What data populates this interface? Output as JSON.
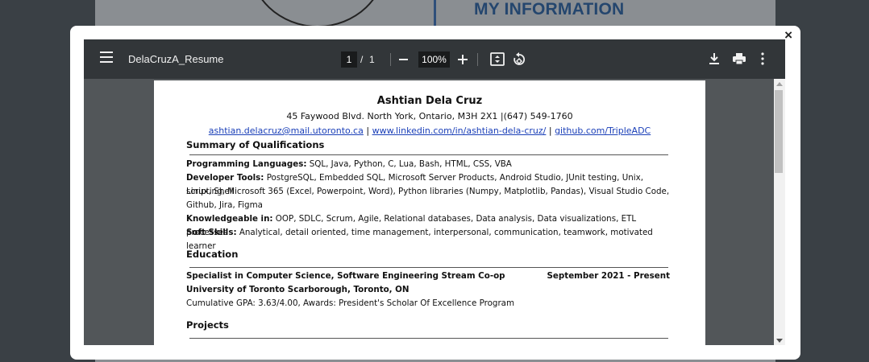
{
  "background": {
    "heading": "MY INFORMATION"
  },
  "modal": {
    "close_label": "×"
  },
  "toolbar": {
    "filename": "DelaCruzA_Resume",
    "current_page": "1",
    "page_separator": "/",
    "total_pages": "1",
    "zoom": "100%",
    "icons": [
      "menu-icon",
      "zoom-out-icon",
      "zoom-in-icon",
      "fit-page-icon",
      "rotate-icon",
      "download-icon",
      "print-icon",
      "more-options-icon"
    ]
  },
  "resume": {
    "name": "Ashtian Dela Cruz",
    "address": "45 Faywood Blvd. North York, Ontario, M3H 2X1 |(647) 549-1760",
    "email": "ashtian.delacruz@mail.utoronto.ca",
    "linkedin": "www.linkedin.com/in/ashtian-dela-cruz/",
    "github": "github.com/TripleADC",
    "link_separator": "|",
    "summary": {
      "title": "Summary of Qualifications",
      "programming_label": "Programming Languages:",
      "programming_text": " SQL, Java, Python, C, Lua, Bash, HTML, CSS, VBA",
      "tools_label": "Developer Tools:",
      "tools_text_1": " PostgreSQL, Embedded SQL, Microsoft Server Products, Android Studio, JUnit testing, Unix, Linux, Shell",
      "tools_text_2": "scripting, Microsoft 365 (Excel, Powerpoint, Word), Python libraries (Numpy, Matplotlib, Pandas), Visual Studio Code,",
      "tools_text_3": "Github, Jira, Figma",
      "knowledge_label": "Knowledgeable in:",
      "knowledge_text": " OOP, SDLC, Scrum, Agile, Relational databases, Data analysis, Data visualizations, ETL processes",
      "soft_label": "Soft Skills:",
      "soft_text": " Analytical, detail oriented, time management, interpersonal, communication, teamwork, motivated learner"
    },
    "education": {
      "title": "Education",
      "program": "Specialist in Computer Science, Software Engineering Stream Co-op",
      "dates": "September 2021 - Present",
      "school": "University of Toronto Scarborough, Toronto, ON",
      "gpa": "Cumulative GPA: 3.63/4.00, Awards: President's Scholar Of Excellence Program"
    },
    "projects": {
      "title": "Projects"
    }
  }
}
